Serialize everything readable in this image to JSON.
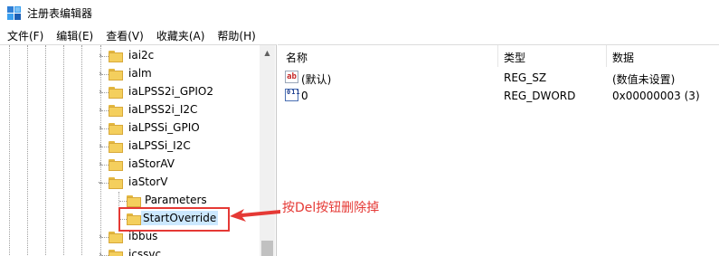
{
  "window": {
    "title": "注册表编辑器"
  },
  "menu": {
    "items": [
      "文件(F)",
      "编辑(E)",
      "查看(V)",
      "收藏夹(A)",
      "帮助(H)"
    ]
  },
  "tree": {
    "items": [
      {
        "label": "iai2c",
        "expandable": true,
        "expanded": false
      },
      {
        "label": "ialm",
        "expandable": true,
        "expanded": false
      },
      {
        "label": "iaLPSS2i_GPIO2",
        "expandable": true,
        "expanded": false
      },
      {
        "label": "iaLPSS2i_I2C",
        "expandable": true,
        "expanded": false
      },
      {
        "label": "iaLPSSi_GPIO",
        "expandable": true,
        "expanded": false
      },
      {
        "label": "iaLPSSi_I2C",
        "expandable": true,
        "expanded": false
      },
      {
        "label": "iaStorAV",
        "expandable": true,
        "expanded": false
      },
      {
        "label": "iaStorV",
        "expandable": true,
        "expanded": true
      },
      {
        "label": "Parameters",
        "expandable": false,
        "expanded": false
      },
      {
        "label": "StartOverride",
        "expandable": false,
        "expanded": false,
        "selected": true
      },
      {
        "label": "ibbus",
        "expandable": true,
        "expanded": false
      },
      {
        "label": "icssvc",
        "expandable": true,
        "expanded": false
      }
    ]
  },
  "list": {
    "headers": {
      "name": "名称",
      "type": "类型",
      "data": "数据"
    },
    "rows": [
      {
        "icon": "string-value-icon",
        "icon_text": "ab",
        "name": "(默认)",
        "type": "REG_SZ",
        "data": "(数值未设置)"
      },
      {
        "icon": "dword-value-icon",
        "icon_text": "011",
        "name": "0",
        "type": "REG_DWORD",
        "data": "0x00000003 (3)"
      }
    ]
  },
  "annotation": {
    "text": "按Del按钮删除掉",
    "color": "#e53935"
  },
  "colors": {
    "selection": "#cce8ff",
    "folder": "#f4cf5d",
    "highlight": "#e53935"
  }
}
